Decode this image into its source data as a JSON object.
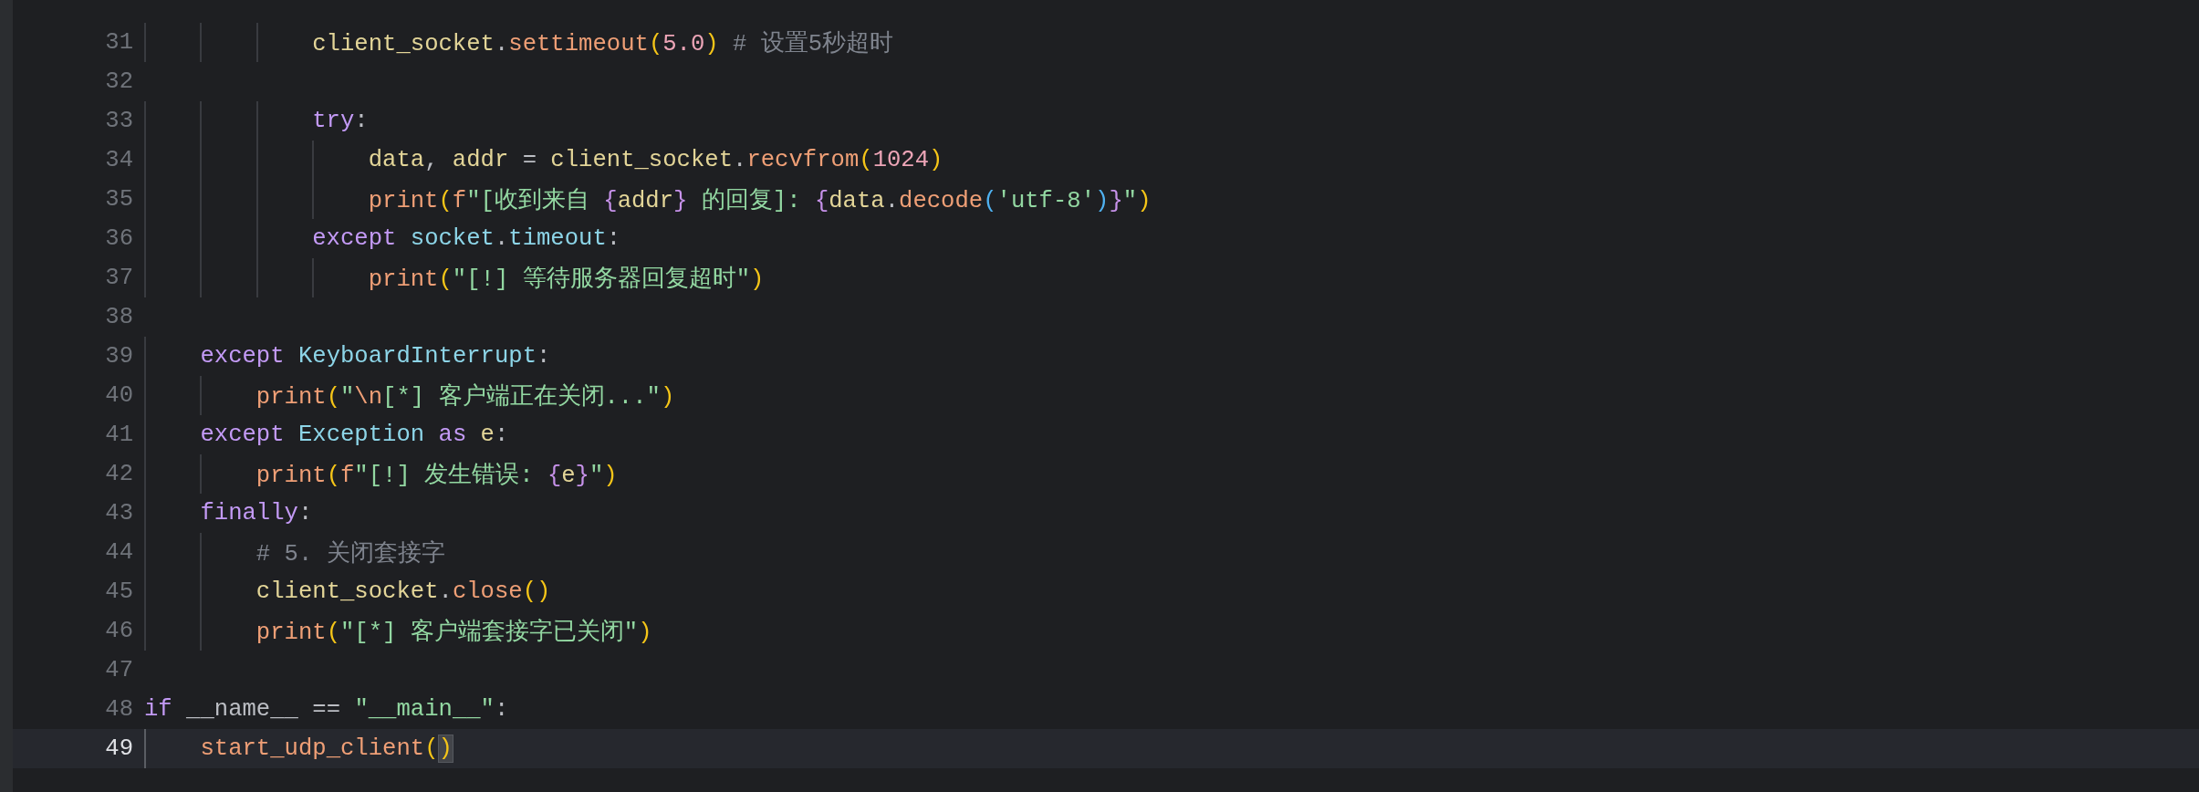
{
  "editor": {
    "lines": [
      {
        "children": [
          {
            "children": [
              {
                "children": [
                  {
                    "number": "31",
                    "current": false,
                    "tokens": [
                      {
                        "kind": "var",
                        "text": "client_socket"
                      },
                      {
                        "kind": "op",
                        "text": "."
                      },
                      {
                        "kind": "fn",
                        "text": "settimeout"
                      },
                      {
                        "kind": "p1",
                        "text": "("
                      },
                      {
                        "kind": "num",
                        "text": "5.0"
                      },
                      {
                        "kind": "p1",
                        "text": ") "
                      },
                      {
                        "kind": "cmt",
                        "text": "# 设置5秒超时"
                      }
                    ]
                  },
                  {
                    "number": "32",
                    "current": false
                  },
                  {
                    "number": "33",
                    "current": false,
                    "tokens": [
                      {
                        "kind": "kw",
                        "text": "try"
                      },
                      {
                        "kind": "op",
                        "text": ":"
                      }
                    ],
                    "children": [
                      {
                        "number": "34",
                        "current": false,
                        "tokens": [
                          {
                            "kind": "var",
                            "text": "data"
                          },
                          {
                            "kind": "op",
                            "text": ", "
                          },
                          {
                            "kind": "var",
                            "text": "addr"
                          },
                          {
                            "kind": "op",
                            "text": " = "
                          },
                          {
                            "kind": "var",
                            "text": "client_socket"
                          },
                          {
                            "kind": "op",
                            "text": "."
                          },
                          {
                            "kind": "fn",
                            "text": "recvfrom"
                          },
                          {
                            "kind": "p1",
                            "text": "("
                          },
                          {
                            "kind": "num",
                            "text": "1024"
                          },
                          {
                            "kind": "p1",
                            "text": ")"
                          }
                        ]
                      },
                      {
                        "number": "35",
                        "current": false,
                        "tokens": [
                          {
                            "kind": "fn",
                            "text": "print"
                          },
                          {
                            "kind": "p1",
                            "text": "("
                          },
                          {
                            "kind": "fn",
                            "text": "f"
                          },
                          {
                            "kind": "str",
                            "text": "\"[收到来自 "
                          },
                          {
                            "kind": "brace",
                            "text": "{"
                          },
                          {
                            "kind": "var",
                            "text": "addr"
                          },
                          {
                            "kind": "brace",
                            "text": "}"
                          },
                          {
                            "kind": "str",
                            "text": " 的回复]: "
                          },
                          {
                            "kind": "brace",
                            "text": "{"
                          },
                          {
                            "kind": "var",
                            "text": "data"
                          },
                          {
                            "kind": "op",
                            "text": "."
                          },
                          {
                            "kind": "fn",
                            "text": "decode"
                          },
                          {
                            "kind": "p2",
                            "text": "("
                          },
                          {
                            "kind": "str",
                            "text": "'utf-8'"
                          },
                          {
                            "kind": "p2",
                            "text": ")"
                          },
                          {
                            "kind": "brace",
                            "text": "}"
                          },
                          {
                            "kind": "str",
                            "text": "\""
                          },
                          {
                            "kind": "p1",
                            "text": ")"
                          }
                        ]
                      }
                    ]
                  },
                  {
                    "number": "36",
                    "current": false,
                    "tokens": [
                      {
                        "kind": "kw",
                        "text": "except "
                      },
                      {
                        "kind": "cls",
                        "text": "socket"
                      },
                      {
                        "kind": "op",
                        "text": "."
                      },
                      {
                        "kind": "cls",
                        "text": "timeout"
                      },
                      {
                        "kind": "op",
                        "text": ":"
                      }
                    ],
                    "children": [
                      {
                        "number": "37",
                        "current": false,
                        "tokens": [
                          {
                            "kind": "fn",
                            "text": "print"
                          },
                          {
                            "kind": "p1",
                            "text": "("
                          },
                          {
                            "kind": "str",
                            "text": "\"[!] 等待服务器回复超时\""
                          },
                          {
                            "kind": "p1",
                            "text": ")"
                          }
                        ]
                      }
                    ]
                  }
                ]
              },
              {
                "number": "38",
                "current": false
              }
            ]
          },
          {
            "number": "39",
            "current": false,
            "tokens": [
              {
                "kind": "kw",
                "text": "except "
              },
              {
                "kind": "cls",
                "text": "KeyboardInterrupt"
              },
              {
                "kind": "op",
                "text": ":"
              }
            ],
            "children": [
              {
                "number": "40",
                "current": false,
                "tokens": [
                  {
                    "kind": "fn",
                    "text": "print"
                  },
                  {
                    "kind": "p1",
                    "text": "("
                  },
                  {
                    "kind": "str",
                    "text": "\""
                  },
                  {
                    "kind": "fn",
                    "text": "\\n"
                  },
                  {
                    "kind": "str",
                    "text": "[*] 客户端正在关闭...\""
                  },
                  {
                    "kind": "p1",
                    "text": ")"
                  }
                ]
              }
            ]
          },
          {
            "number": "41",
            "current": false,
            "tokens": [
              {
                "kind": "kw",
                "text": "except "
              },
              {
                "kind": "cls",
                "text": "Exception "
              },
              {
                "kind": "kw",
                "text": "as "
              },
              {
                "kind": "var",
                "text": "e"
              },
              {
                "kind": "op",
                "text": ":"
              }
            ],
            "children": [
              {
                "number": "42",
                "current": false,
                "tokens": [
                  {
                    "kind": "fn",
                    "text": "print"
                  },
                  {
                    "kind": "p1",
                    "text": "("
                  },
                  {
                    "kind": "fn",
                    "text": "f"
                  },
                  {
                    "kind": "str",
                    "text": "\"[!] 发生错误: "
                  },
                  {
                    "kind": "brace",
                    "text": "{"
                  },
                  {
                    "kind": "var",
                    "text": "e"
                  },
                  {
                    "kind": "brace",
                    "text": "}"
                  },
                  {
                    "kind": "str",
                    "text": "\""
                  },
                  {
                    "kind": "p1",
                    "text": ")"
                  }
                ]
              }
            ]
          },
          {
            "number": "43",
            "current": false,
            "tokens": [
              {
                "kind": "kw",
                "text": "finally"
              },
              {
                "kind": "op",
                "text": ":"
              }
            ],
            "children": [
              {
                "number": "44",
                "current": false,
                "tokens": [
                  {
                    "kind": "cmt",
                    "text": "# 5. 关闭套接字"
                  }
                ]
              },
              {
                "number": "45",
                "current": false,
                "tokens": [
                  {
                    "kind": "var",
                    "text": "client_socket"
                  },
                  {
                    "kind": "op",
                    "text": "."
                  },
                  {
                    "kind": "fn",
                    "text": "close"
                  },
                  {
                    "kind": "p1",
                    "text": "("
                  },
                  {
                    "kind": "p1",
                    "text": ")"
                  }
                ]
              },
              {
                "number": "46",
                "current": false,
                "tokens": [
                  {
                    "kind": "fn",
                    "text": "print"
                  },
                  {
                    "kind": "p1",
                    "text": "("
                  },
                  {
                    "kind": "str",
                    "text": "\"[*] 客户端套接字已关闭\""
                  },
                  {
                    "kind": "p1",
                    "text": ")"
                  }
                ]
              }
            ]
          }
        ]
      },
      {
        "number": "47",
        "current": false
      },
      {
        "number": "48",
        "current": false,
        "tokens": [
          {
            "kind": "kw",
            "text": "if "
          },
          {
            "kind": "op",
            "text": "__name__ == "
          },
          {
            "kind": "str",
            "text": "\"__main__\""
          },
          {
            "kind": "op",
            "text": ":"
          }
        ],
        "children": [
          {
            "number": "49",
            "current": true,
            "tokens": [
              {
                "kind": "fn",
                "text": "start_udp_client"
              },
              {
                "kind": "p1",
                "text": "("
              },
              {
                "kind": "match",
                "text": ")"
              }
            ]
          }
        ]
      }
    ]
  }
}
